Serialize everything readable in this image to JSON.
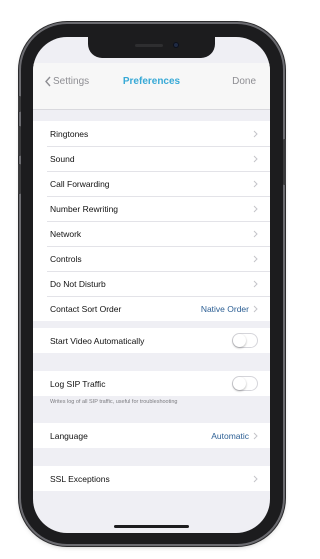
{
  "nav": {
    "back_label": "Settings",
    "title": "Preferences",
    "done_label": "Done"
  },
  "group1": [
    {
      "label": "Ringtones"
    },
    {
      "label": "Sound"
    },
    {
      "label": "Call Forwarding"
    },
    {
      "label": "Number Rewriting"
    },
    {
      "label": "Network"
    },
    {
      "label": "Controls"
    },
    {
      "label": "Do Not Disturb"
    },
    {
      "label": "Contact Sort Order",
      "value": "Native Order"
    }
  ],
  "video": {
    "label": "Start Video Automatically",
    "on": false
  },
  "sip": {
    "label": "Log SIP Traffic",
    "on": false,
    "note": "Writes log of all SIP traffic, useful for troubleshooting"
  },
  "language": {
    "label": "Language",
    "value": "Automatic"
  },
  "ssl": {
    "label": "SSL Exceptions"
  },
  "colors": {
    "accent": "#37a9d6",
    "value_text": "#2c5f94",
    "background": "#efeff4"
  },
  "icons": {
    "back": "chevron-left-icon",
    "disclosure": "chevron-right-icon"
  }
}
